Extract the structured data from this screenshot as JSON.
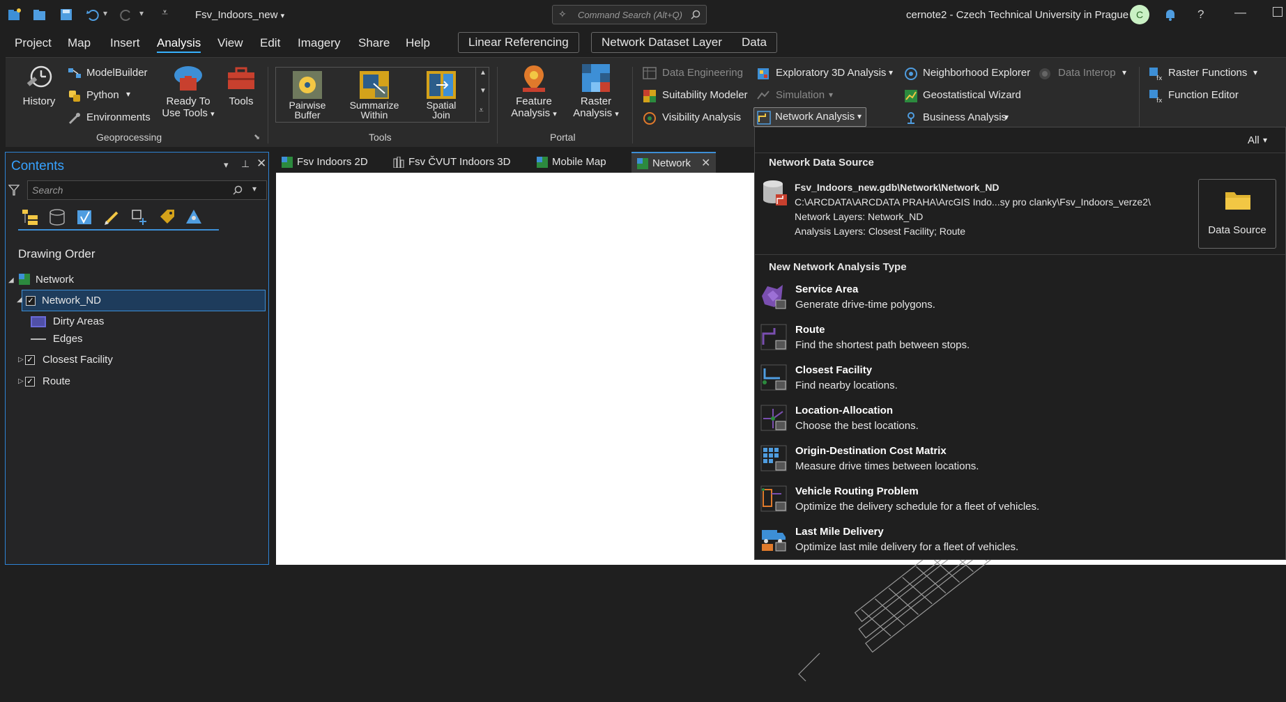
{
  "titlebar": {
    "project_name": "Fsv_Indoors_new",
    "search_placeholder": "Command Search (Alt+Q)",
    "user": "cernote2 - Czech Technical University in Prague",
    "avatar_initial": "C",
    "help": "?"
  },
  "menu": {
    "items": [
      "Project",
      "Map",
      "Insert",
      "Analysis",
      "View",
      "Edit",
      "Imagery",
      "Share",
      "Help"
    ],
    "active": "Analysis",
    "contextual_tabs": [
      "Linear Referencing",
      "Network Dataset Layer",
      "Data"
    ]
  },
  "ribbon": {
    "geoprocessing": {
      "history": "History",
      "modelbuilder": "ModelBuilder",
      "python": "Python",
      "environments": "Environments",
      "ready_to_use_1": "Ready To",
      "ready_to_use_2": "Use Tools",
      "tools": "Tools",
      "group_label": "Geoprocessing"
    },
    "tools_gallery": {
      "pairwise_1": "Pairwise",
      "pairwise_2": "Buffer",
      "summarize_1": "Summarize",
      "summarize_2": "Within",
      "spatial_1": "Spatial",
      "spatial_2": "Join",
      "group_label": "Tools"
    },
    "portal": {
      "feature_1": "Feature",
      "feature_2": "Analysis",
      "raster_1": "Raster",
      "raster_2": "Analysis",
      "group_label": "Portal"
    },
    "workflows": {
      "data_engineering": "Data Engineering",
      "suitability_modeler": "Suitability Modeler",
      "visibility_analysis": "Visibility Analysis",
      "exploratory_3d": "Exploratory 3D Analysis",
      "simulation": "Simulation",
      "network_analysis": "Network Analysis",
      "neighborhood_explorer": "Neighborhood Explorer",
      "geostatistical_wizard": "Geostatistical Wizard",
      "business_analysis": "Business Analysis",
      "data_interop": "Data Interop"
    },
    "raster": {
      "raster_functions": "Raster Functions",
      "function_editor": "Function Editor"
    }
  },
  "contents": {
    "title": "Contents",
    "search_placeholder": "Search",
    "drawing_order": "Drawing Order",
    "tree": {
      "map": "Network",
      "network_nd": "Network_ND",
      "dirty_areas": "Dirty Areas",
      "edges": "Edges",
      "closest_facility": "Closest Facility",
      "route": "Route"
    }
  },
  "view_tabs": [
    "Fsv Indoors 2D",
    "Fsv ČVUT Indoors 3D",
    "Mobile Map",
    "Network"
  ],
  "dropdown": {
    "filter": "All",
    "data_source_heading": "Network Data Source",
    "source_name": "Fsv_Indoors_new.gdb\\Network\\Network_ND",
    "source_path": "C:\\ARCDATA\\ARCDATA PRAHA\\ArcGIS Indo...sy pro clanky\\Fsv_Indoors_verze2\\",
    "network_layers": "Network Layers: Network_ND",
    "analysis_layers": "Analysis Layers: Closest Facility; Route",
    "data_source_button": "Data Source",
    "new_type_heading": "New Network Analysis Type",
    "types": [
      {
        "title": "Service Area",
        "desc": "Generate drive-time polygons."
      },
      {
        "title": "Route",
        "desc": "Find the shortest path between stops."
      },
      {
        "title": "Closest Facility",
        "desc": "Find nearby locations."
      },
      {
        "title": "Location-Allocation",
        "desc": "Choose the best locations."
      },
      {
        "title": "Origin-Destination Cost Matrix",
        "desc": "Measure drive times between locations."
      },
      {
        "title": "Vehicle Routing Problem",
        "desc": "Optimize the delivery schedule for a fleet of vehicles."
      },
      {
        "title": "Last Mile Delivery",
        "desc": "Optimize last mile delivery for a fleet of vehicles."
      }
    ]
  },
  "colors": {
    "accent": "#37a2ff",
    "background": "#1f1f1f",
    "ribbon": "#2b2b2b"
  }
}
